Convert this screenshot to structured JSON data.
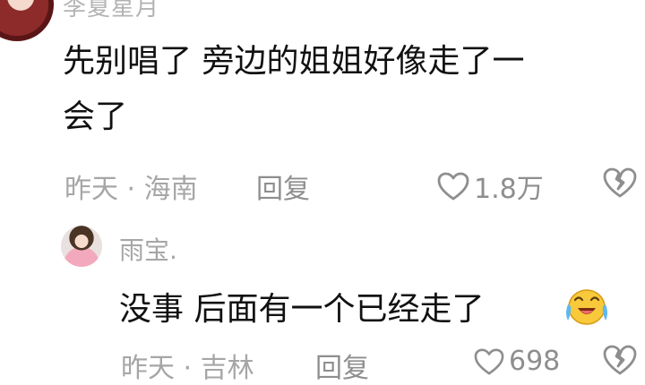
{
  "top_comment": {
    "author": "李夏星月",
    "text_line1": "先别唱了 旁边的姐姐好像走了一",
    "text_line2": "会了",
    "meta": "昨天 · 海南",
    "reply_label": "回复",
    "like_count": "1.8万"
  },
  "reply_comment": {
    "author": "雨宝.",
    "text": "没事 后面有一个已经走了",
    "emoji_name": "laughing-tears-emoji",
    "meta": "昨天 · 吉林",
    "reply_label": "回复",
    "like_count": "698"
  },
  "colors": {
    "muted": "#a6a6a6",
    "icon": "#8e8e8e",
    "text": "#111111"
  }
}
